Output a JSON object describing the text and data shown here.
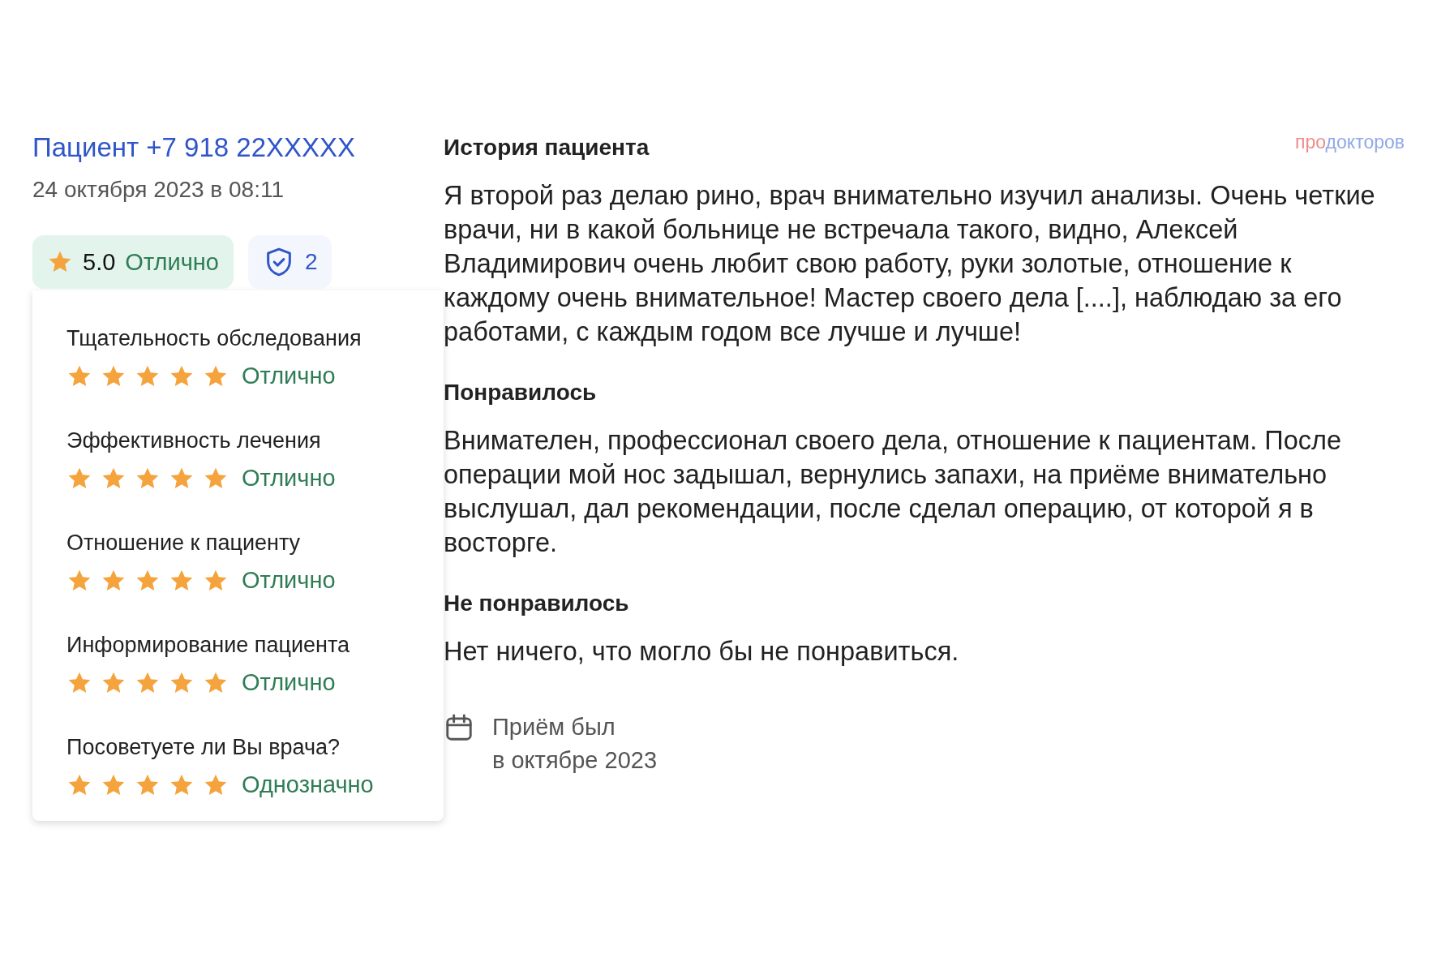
{
  "author": {
    "name": "Пациент +7 918 22XXXXX",
    "date": "24 октября 2023 в 08:11"
  },
  "rating": {
    "value": "5.0",
    "verdict": "Отлично"
  },
  "verified": {
    "count": "2"
  },
  "criteria": [
    {
      "label": "Тщательность обследования",
      "stars": 5,
      "verdict": "Отлично"
    },
    {
      "label": "Эффективность лечения",
      "stars": 5,
      "verdict": "Отлично"
    },
    {
      "label": "Отношение к пациенту",
      "stars": 5,
      "verdict": "Отлично"
    },
    {
      "label": "Информирование пациента",
      "stars": 5,
      "verdict": "Отлично"
    },
    {
      "label": "Посоветуете ли Вы врача?",
      "stars": 5,
      "verdict": "Однозначно"
    }
  ],
  "logo": [
    {
      "text": "про",
      "color": "#ef8a8a"
    },
    {
      "text": "докторов",
      "color": "#8fa8e8"
    }
  ],
  "sections": [
    {
      "heading": "История пациента",
      "text": "Я второй раз делаю рино, врач внимательно изучил анализы. Очень четкие врачи, ни в какой больнице не встречала такого, видно, Алексей Владимирович очень любит свою работу, руки золотые, отношение к каждому очень внимательное! Мастер своего дела [....], наблюдаю за его работами, с каждым годом все лучше и лучше!"
    },
    {
      "heading": "Понравилось",
      "text": "Внимателен, профессионал своего дела, отношение к пациентам. После операции мой нос задышал, вернулись запахи, на приёме внимательно выслушал, дал рекомендации, после сделал операцию, от которой я в восторге."
    },
    {
      "heading": "Не понравилось",
      "text": "Нет ничего, что могло бы не понравиться."
    }
  ],
  "visit": {
    "line1": "Приём был",
    "line2": "в октябре 2023"
  }
}
